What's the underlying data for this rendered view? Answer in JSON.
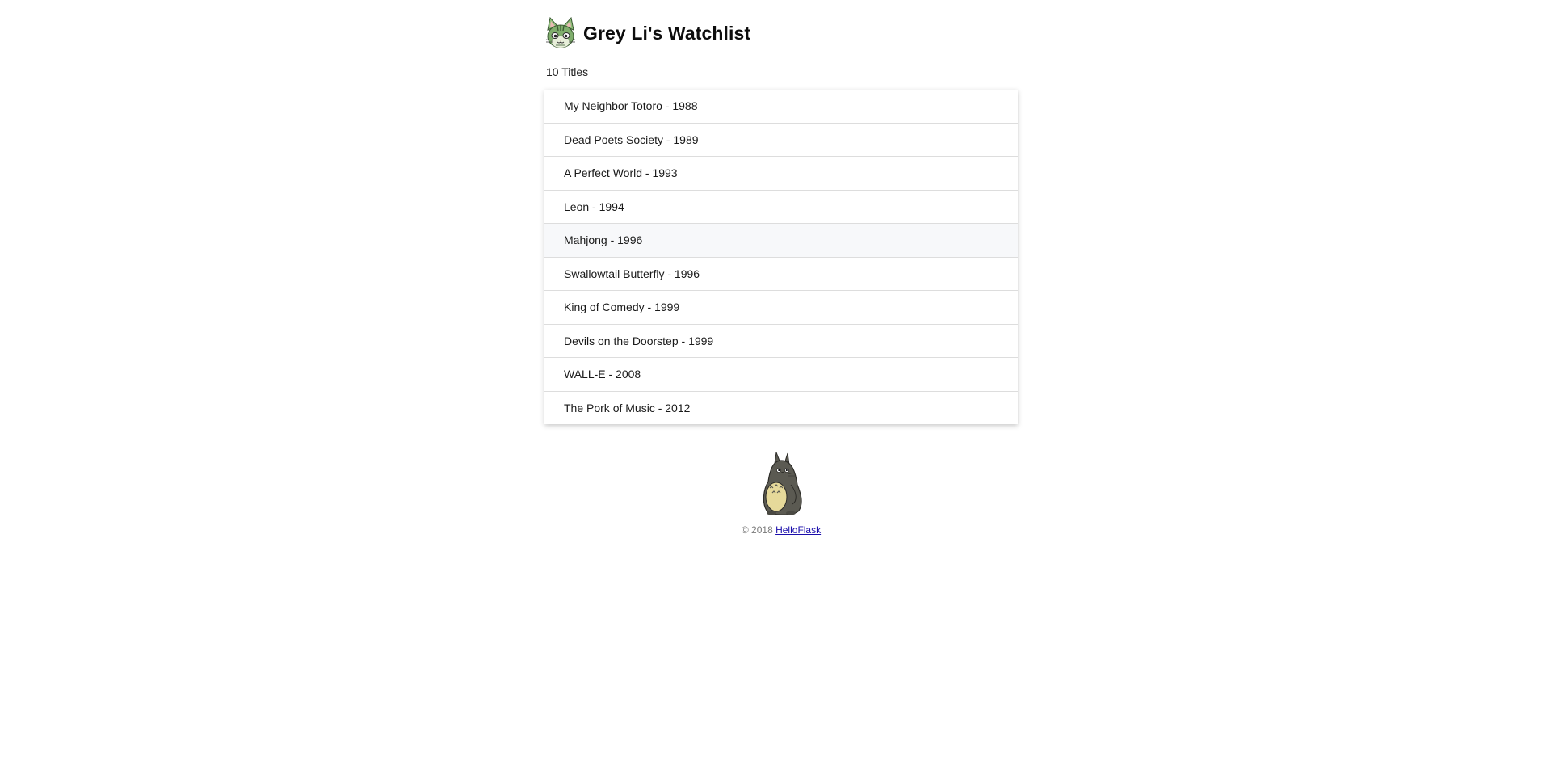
{
  "header": {
    "title": "Grey Li's Watchlist",
    "avatar_icon": "cat-avatar-icon"
  },
  "summary": {
    "count_text": "10 Titles"
  },
  "movies": [
    {
      "text": "My Neighbor Totoro - 1988"
    },
    {
      "text": "Dead Poets Society - 1989"
    },
    {
      "text": "A Perfect World - 1993"
    },
    {
      "text": "Leon - 1994"
    },
    {
      "text": "Mahjong - 1996"
    },
    {
      "text": "Swallowtail Butterfly - 1996"
    },
    {
      "text": "King of Comedy - 1999"
    },
    {
      "text": "Devils on the Doorstep - 1999"
    },
    {
      "text": "WALL-E - 2008"
    },
    {
      "text": "The Pork of Music - 2012"
    }
  ],
  "footer": {
    "mascot_icon": "totoro-icon",
    "copyright": "© 2018",
    "link_text": "HelloFlask"
  },
  "colors": {
    "link": "#1a0dab",
    "hover_row": "#f7f8fa",
    "divider": "#dddddd"
  }
}
